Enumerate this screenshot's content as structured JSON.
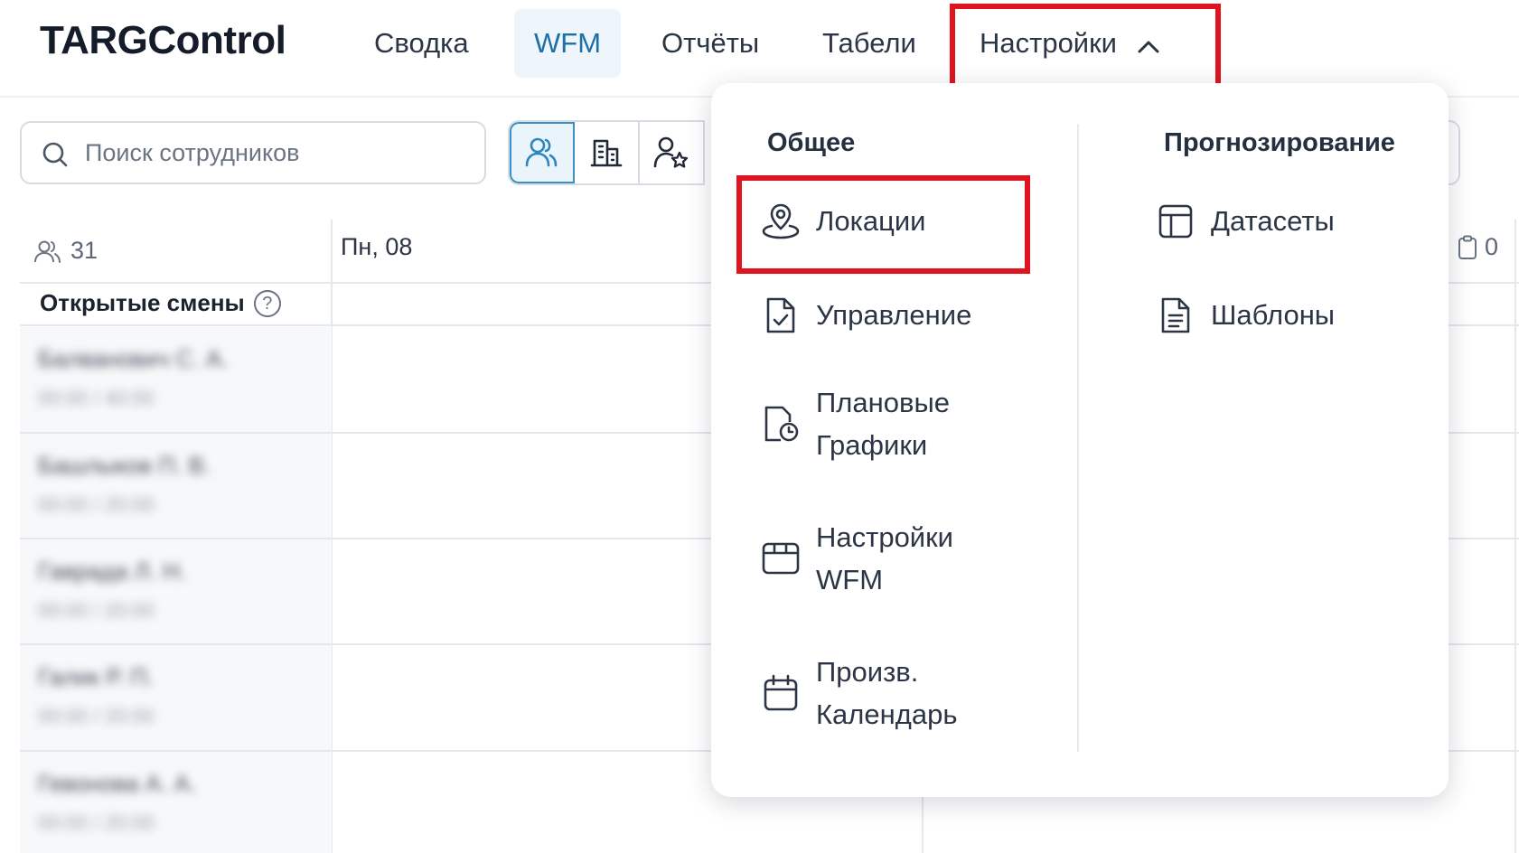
{
  "app": {
    "logo": "TARGControl"
  },
  "nav": {
    "items": [
      {
        "label": "Сводка",
        "active": false
      },
      {
        "label": "WFM",
        "active": true
      },
      {
        "label": "Отчёты",
        "active": false
      },
      {
        "label": "Табели",
        "active": false
      },
      {
        "label": "Настройки",
        "active": false,
        "expanded": true
      }
    ]
  },
  "toolbar": {
    "search_placeholder": "Поиск сотрудников",
    "view_buttons": [
      "users-icon",
      "building-icon",
      "user-star-icon"
    ]
  },
  "grid": {
    "employee_count": "31",
    "day_header": "Пн, 08",
    "right_counter": "0",
    "open_shifts_label": "Открытые смены",
    "help_glyph": "?",
    "employees": [
      {
        "name": "Балванович С. А.",
        "hours": "00:00 / 40:00"
      },
      {
        "name": "Башлыков П. В.",
        "hours": "00:00 / 20:00"
      },
      {
        "name": "Гаврада Л. Н.",
        "hours": "00:00 / 20:00"
      },
      {
        "name": "Галик Р. П.",
        "hours": "00:00 / 20:00"
      },
      {
        "name": "Гевонова А. А.",
        "hours": "00:00 / 20:00"
      }
    ]
  },
  "settings_menu": {
    "general": {
      "title": "Общее",
      "items": [
        {
          "label": "Локации",
          "icon": "location-pin-icon",
          "highlighted": true
        },
        {
          "label": "Управление",
          "icon": "document-check-icon"
        },
        {
          "label": "Плановые Графики",
          "icon": "document-clock-icon"
        },
        {
          "label": "Настройки WFM",
          "icon": "browser-window-icon"
        },
        {
          "label": "Произв. Календарь",
          "icon": "calendar-icon"
        }
      ]
    },
    "forecasting": {
      "title": "Прогнозирование",
      "items": [
        {
          "label": "Датасеты",
          "icon": "table-icon"
        },
        {
          "label": "Шаблоны",
          "icon": "document-lines-icon"
        }
      ]
    }
  },
  "colors": {
    "accent": "#1d6fa8",
    "highlight": "#e0141e",
    "active_bg": "#eef6fb"
  }
}
